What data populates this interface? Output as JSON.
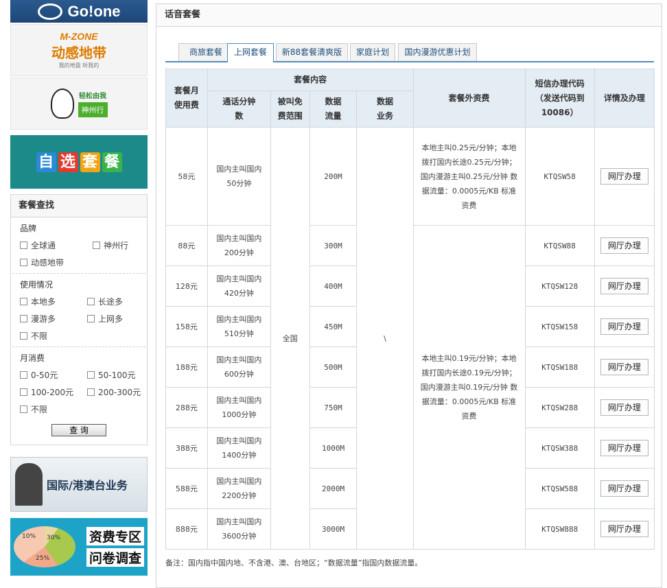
{
  "sidebar": {
    "gotone_label": "Go!one",
    "mzone": {
      "brand": "M-ZONE",
      "title": "动感地带",
      "slogan": "我的地盘 听我的"
    },
    "szx": {
      "slogan": "轻松由我",
      "brand": "神州行"
    },
    "zixuan_chars": [
      "自",
      "选",
      "套",
      "餐"
    ],
    "search": {
      "title": "套餐查找",
      "groups": [
        {
          "title": "品牌",
          "rows": [
            [
              "全球通",
              "神州行"
            ],
            [
              "动感地带"
            ]
          ]
        },
        {
          "title": "使用情况",
          "rows": [
            [
              "本地多",
              "长途多"
            ],
            [
              "漫游多",
              "上网多"
            ],
            [
              "不限"
            ]
          ]
        },
        {
          "title": "月消费",
          "rows": [
            [
              "0-50元",
              "50-100元"
            ],
            [
              "100-200元",
              "200-300元"
            ],
            [
              "不限"
            ]
          ]
        }
      ],
      "button": "查 询"
    },
    "intl_banner": "国际/港澳台业务",
    "survey": {
      "pie_labels": [
        "10%",
        "30%",
        "25%"
      ],
      "line1": "资费专区",
      "line2": "问卷调查"
    }
  },
  "main": {
    "title": "话音套餐",
    "tabs": [
      "商旅套餐",
      "上网套餐",
      "新88套餐清爽版",
      "家庭计划",
      "国内漫游优惠计划"
    ],
    "active_tab": 1,
    "table": {
      "headers": {
        "fee": "套餐月使用费",
        "content": "套餐内容",
        "minutes": "通话分钟数",
        "free_range": "被叫免费范围",
        "data_flow": "数据流量",
        "data_service": "数据业务",
        "extra": "套餐外资费",
        "sms_code": "短信办理代码（发送代码到10086）",
        "action": "详情及办理"
      },
      "free_range_value": "全国",
      "data_service_value": "\\",
      "extra_fees": [
        "本地主叫0.25元/分钟；本地拨打国内长途0.25元/分钟；国内漫游主叫0.25元/分钟 数据流量：0.0005元/KB 标准资费",
        "本地主叫0.19元/分钟；本地拨打国内长途0.19元/分钟；国内漫游主叫0.19元/分钟 数据流量：0.0005元/KB 标准资费"
      ],
      "action_label": "网厅办理",
      "rows": [
        {
          "fee": "58元",
          "minutes": "国内主叫国内50分钟",
          "data": "200M",
          "code": "KTQSW58"
        },
        {
          "fee": "88元",
          "minutes": "国内主叫国内200分钟",
          "data": "300M",
          "code": "KTQSW88"
        },
        {
          "fee": "128元",
          "minutes": "国内主叫国内420分钟",
          "data": "400M",
          "code": "KTQSW128"
        },
        {
          "fee": "158元",
          "minutes": "国内主叫国内510分钟",
          "data": "450M",
          "code": "KTQSW158"
        },
        {
          "fee": "188元",
          "minutes": "国内主叫国内600分钟",
          "data": "500M",
          "code": "KTQSW188"
        },
        {
          "fee": "288元",
          "minutes": "国内主叫国内1000分钟",
          "data": "750M",
          "code": "KTQSW288"
        },
        {
          "fee": "388元",
          "minutes": "国内主叫国内1400分钟",
          "data": "1000M",
          "code": "KTQSW388"
        },
        {
          "fee": "588元",
          "minutes": "国内主叫国内2200分钟",
          "data": "2000M",
          "code": "KTQSW588"
        },
        {
          "fee": "888元",
          "minutes": "国内主叫国内3600分钟",
          "data": "3000M",
          "code": "KTQSW888"
        }
      ]
    },
    "note": "备注：国内指中国内地、不含港、澳、台地区；“数据流量”指国内数据流量。"
  }
}
